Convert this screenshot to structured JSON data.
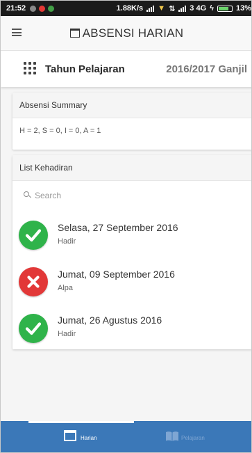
{
  "statusbar": {
    "time": "21:52",
    "right_text": "1.88K/s",
    "network": "3 4G",
    "battery": "13%"
  },
  "header": {
    "title": "ABSENSI HARIAN"
  },
  "year": {
    "label": "Tahun Pelajaran",
    "value": "2016/2017 Ganjil"
  },
  "summary": {
    "title": "Absensi Summary",
    "text": "H = 2, S = 0, I = 0, A = 1"
  },
  "list": {
    "title": "List Kehadiran",
    "search_placeholder": "Search",
    "items": [
      {
        "date": "Selasa, 27 September 2016",
        "status": "Hadir",
        "icon": "check-icon",
        "color": "#2fb34a"
      },
      {
        "date": "Jumat, 09 September 2016",
        "status": "Alpa",
        "icon": "cross-icon",
        "color": "#e23838"
      },
      {
        "date": "Jumat, 26 Agustus 2016",
        "status": "Hadir",
        "icon": "check-icon",
        "color": "#2fb34a"
      }
    ]
  },
  "bottomnav": {
    "tabs": [
      {
        "label": "Harian",
        "icon": "calendar-icon",
        "active": true
      },
      {
        "label": "Pelajaran",
        "icon": "book-icon",
        "active": false
      }
    ],
    "color": "#3b78b8"
  }
}
